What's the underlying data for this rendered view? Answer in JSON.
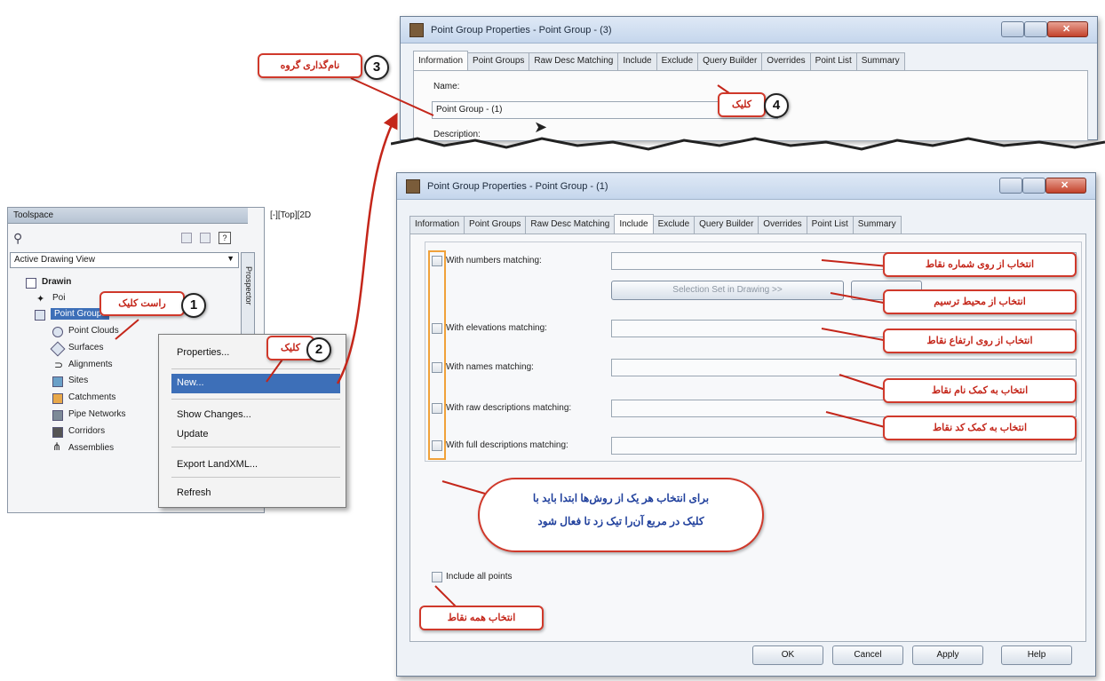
{
  "top_dialog": {
    "title": "Point Group Properties - Point Group - (3)",
    "tabs": [
      "Information",
      "Point Groups",
      "Raw Desc Matching",
      "Include",
      "Exclude",
      "Query Builder",
      "Overrides",
      "Point List",
      "Summary"
    ],
    "name_label": "Name:",
    "name_value": "Point Group - (1)",
    "desc_label": "Description:"
  },
  "main_dialog": {
    "title": "Point Group Properties - Point Group - (1)",
    "tabs": [
      "Information",
      "Point Groups",
      "Raw Desc Matching",
      "Include",
      "Exclude",
      "Query Builder",
      "Overrides",
      "Point List",
      "Summary"
    ],
    "active_tab": "Include",
    "options": [
      "With numbers matching:",
      "With elevations matching:",
      "With names matching:",
      "With raw descriptions matching:",
      "With full descriptions matching:"
    ],
    "selection_button": "Selection Set in Drawing >>",
    "include_all": "Include all points",
    "buttons": {
      "ok": "OK",
      "cancel": "Cancel",
      "apply": "Apply",
      "help": "Help"
    }
  },
  "toolspace": {
    "title": "Toolspace",
    "view_select": "Active Drawing View",
    "side_tab": "Prospector",
    "viewport_label": "[-][Top][2D",
    "tree": [
      "Drawing",
      "Points",
      "Point Groups",
      "Point Clouds",
      "Surfaces",
      "Alignments",
      "Sites",
      "Catchments",
      "Pipe Networks",
      "Corridors",
      "Assemblies"
    ],
    "root_label": "Drawin",
    "points_label": "Poi"
  },
  "context_menu": {
    "items": [
      "Properties...",
      "New...",
      "Show Changes...",
      "Update",
      "Export LandXML...",
      "Refresh"
    ]
  },
  "annotations": {
    "step1": {
      "num": "1",
      "text": "راست کلیک"
    },
    "step2": {
      "num": "2",
      "text": "کلیک"
    },
    "step3": {
      "num": "3",
      "text": "نام‌گذاری گروه"
    },
    "step4": {
      "num": "4",
      "text": "کلیک"
    },
    "numbers": "انتخاب از روی شماره نقاط",
    "drawing": "انتخاب از محیط ترسیم",
    "elevations": "انتخاب از روی ارتفاع نقاط",
    "names": "انتخاب به کمک نام نقاط",
    "codes": "انتخاب به کمک کد نقاط",
    "checkbox_note_1": "برای انتخاب هر یک از روش‌ها ابتدا باید با",
    "checkbox_note_2": "کلیک در مربع آن‌را تیک زد تا فعال شود",
    "all_points": "انتخاب همه نقاط"
  },
  "colors": {
    "accent_red": "#d0392b",
    "highlight_blue": "#3d6fb8"
  }
}
